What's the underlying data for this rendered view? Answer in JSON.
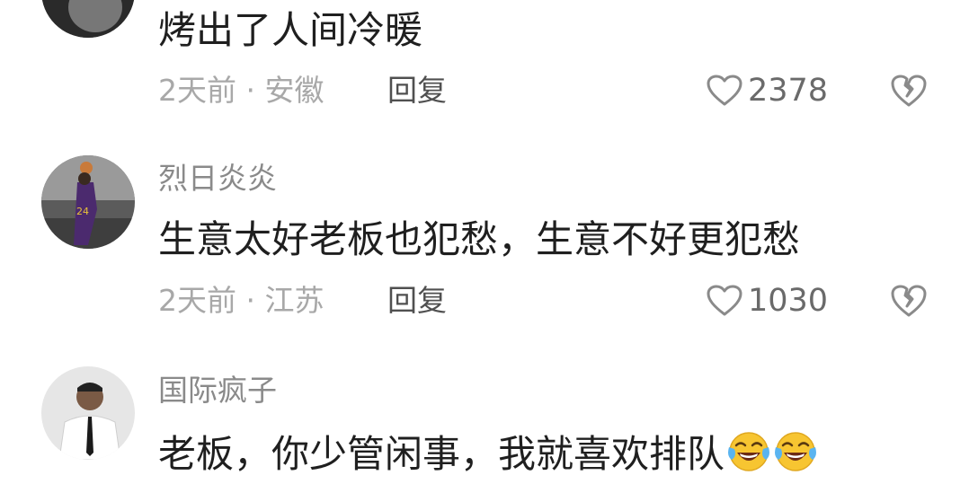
{
  "comments": [
    {
      "text": "烤出了人间冷暖",
      "time_location": "2天前 · 安徽",
      "reply_label": "回复",
      "like_count": "2378"
    },
    {
      "username": "烈日炎炎",
      "text": "生意太好老板也犯愁，生意不好更犯愁",
      "time_location": "2天前 · 江苏",
      "reply_label": "回复",
      "like_count": "1030"
    },
    {
      "username": "国际疯子",
      "text": "老板，你少管闲事，我就喜欢排队",
      "emojis": [
        "laughing-crying-emoji",
        "laughing-crying-emoji"
      ]
    }
  ],
  "icons": {
    "like": "heart-outline-icon",
    "dislike": "broken-heart-icon"
  },
  "colors": {
    "background": "#ffffff",
    "text": "#1f1f1f",
    "username": "#8a8a8a",
    "meta": "#a8a8a8"
  }
}
